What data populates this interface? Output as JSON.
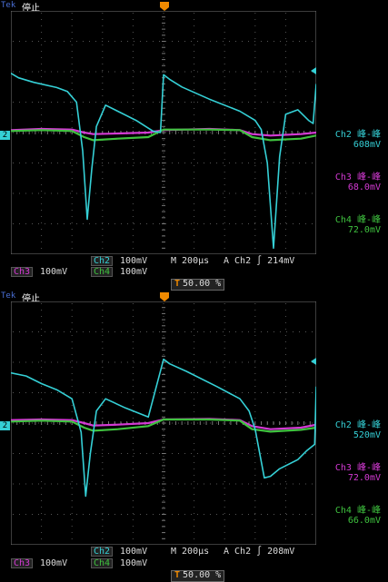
{
  "screens": [
    {
      "id": "top",
      "brand": "Tek",
      "run_state": "停止",
      "ch2_marker": "2",
      "measurements": [
        {
          "label": "Ch2 峰-峰",
          "value": "608mV",
          "color": "#35d0d6"
        },
        {
          "label": "Ch3 峰-峰",
          "value": "68.0mV",
          "color": "#d43ad4"
        },
        {
          "label": "Ch4 峰-峰",
          "value": "72.0mV",
          "color": "#3fc23f"
        }
      ],
      "status": {
        "ch2": "Ch2",
        "ch2_scale": "100mV",
        "ch3": "Ch3",
        "ch3_scale": "100mV",
        "ch4": "Ch4",
        "ch4_scale": "100mV",
        "timebase": "M 200µs",
        "trigger": "A  Ch2  ∫  214mV",
        "trig_pos": "50.00 %",
        "trig_mark": "T"
      }
    },
    {
      "id": "bottom",
      "brand": "Tek",
      "run_state": "停止",
      "ch2_marker": "2",
      "measurements": [
        {
          "label": "Ch2 峰-峰",
          "value": "520mV",
          "color": "#35d0d6"
        },
        {
          "label": "Ch3 峰-峰",
          "value": "72.0mV",
          "color": "#d43ad4"
        },
        {
          "label": "Ch4 峰-峰",
          "value": "66.0mV",
          "color": "#3fc23f"
        }
      ],
      "status": {
        "ch2": "Ch2",
        "ch2_scale": "100mV",
        "ch3": "Ch3",
        "ch3_scale": "100mV",
        "ch4": "Ch4",
        "ch4_scale": "100mV",
        "timebase": "M 200µs",
        "trigger": "A  Ch2  ∫  208mV",
        "trig_pos": "50.00 %",
        "trig_mark": "T"
      }
    }
  ],
  "chart_data": [
    {
      "type": "line",
      "title": "",
      "xlabel": "",
      "ylabel": "",
      "xlim": [
        -1000,
        1000
      ],
      "ylim": [
        -400,
        400
      ],
      "x_unit": "µs",
      "y_unit": "mV",
      "grid": true,
      "series": [
        {
          "name": "Ch2",
          "color": "#35d0d6",
          "points": [
            [
              -1000,
              195
            ],
            [
              -950,
              180
            ],
            [
              -850,
              165
            ],
            [
              -700,
              148
            ],
            [
              -630,
              135
            ],
            [
              -570,
              100
            ],
            [
              -530,
              -60
            ],
            [
              -500,
              -285
            ],
            [
              -470,
              -120
            ],
            [
              -440,
              20
            ],
            [
              -380,
              90
            ],
            [
              -300,
              70
            ],
            [
              -180,
              40
            ],
            [
              -70,
              5
            ],
            [
              -20,
              0
            ],
            [
              0,
              190
            ],
            [
              40,
              175
            ],
            [
              120,
              150
            ],
            [
              300,
              110
            ],
            [
              500,
              70
            ],
            [
              600,
              40
            ],
            [
              640,
              10
            ],
            [
              680,
              -100
            ],
            [
              720,
              -380
            ],
            [
              760,
              -80
            ],
            [
              800,
              60
            ],
            [
              880,
              75
            ],
            [
              950,
              40
            ],
            [
              980,
              30
            ],
            [
              1000,
              160
            ]
          ]
        },
        {
          "name": "Ch3",
          "color": "#d43ad4",
          "points": [
            [
              -1000,
              8
            ],
            [
              -800,
              12
            ],
            [
              -600,
              10
            ],
            [
              -520,
              0
            ],
            [
              -460,
              -5
            ],
            [
              -300,
              -3
            ],
            [
              -100,
              0
            ],
            [
              0,
              8
            ],
            [
              300,
              12
            ],
            [
              500,
              8
            ],
            [
              580,
              -5
            ],
            [
              700,
              -10
            ],
            [
              900,
              -5
            ],
            [
              1000,
              0
            ]
          ]
        },
        {
          "name": "Ch4",
          "color": "#3fc23f",
          "points": [
            [
              -1000,
              5
            ],
            [
              -800,
              8
            ],
            [
              -600,
              5
            ],
            [
              -520,
              -15
            ],
            [
              -460,
              -25
            ],
            [
              -300,
              -20
            ],
            [
              -100,
              -15
            ],
            [
              0,
              10
            ],
            [
              300,
              10
            ],
            [
              500,
              8
            ],
            [
              580,
              -15
            ],
            [
              700,
              -25
            ],
            [
              900,
              -20
            ],
            [
              1000,
              -10
            ]
          ]
        }
      ]
    },
    {
      "type": "line",
      "title": "",
      "xlabel": "",
      "ylabel": "",
      "xlim": [
        -1000,
        1000
      ],
      "ylim": [
        -400,
        400
      ],
      "x_unit": "µs",
      "y_unit": "mV",
      "grid": true,
      "series": [
        {
          "name": "Ch2",
          "color": "#35d0d6",
          "points": [
            [
              -1000,
              165
            ],
            [
              -900,
              155
            ],
            [
              -800,
              130
            ],
            [
              -700,
              110
            ],
            [
              -600,
              80
            ],
            [
              -540,
              -30
            ],
            [
              -510,
              -240
            ],
            [
              -480,
              -100
            ],
            [
              -440,
              40
            ],
            [
              -380,
              80
            ],
            [
              -250,
              50
            ],
            [
              -100,
              20
            ],
            [
              0,
              210
            ],
            [
              40,
              195
            ],
            [
              150,
              170
            ],
            [
              350,
              120
            ],
            [
              500,
              80
            ],
            [
              560,
              40
            ],
            [
              600,
              -20
            ],
            [
              660,
              -180
            ],
            [
              700,
              -175
            ],
            [
              760,
              -150
            ],
            [
              880,
              -120
            ],
            [
              940,
              -90
            ],
            [
              990,
              -70
            ],
            [
              1000,
              120
            ]
          ]
        },
        {
          "name": "Ch3",
          "color": "#d43ad4",
          "points": [
            [
              -1000,
              10
            ],
            [
              -800,
              12
            ],
            [
              -600,
              10
            ],
            [
              -520,
              0
            ],
            [
              -460,
              -8
            ],
            [
              -300,
              -5
            ],
            [
              -100,
              0
            ],
            [
              0,
              12
            ],
            [
              300,
              14
            ],
            [
              500,
              10
            ],
            [
              580,
              -10
            ],
            [
              700,
              -20
            ],
            [
              900,
              -15
            ],
            [
              1000,
              -5
            ]
          ]
        },
        {
          "name": "Ch4",
          "color": "#3fc23f",
          "points": [
            [
              -1000,
              5
            ],
            [
              -800,
              8
            ],
            [
              -600,
              5
            ],
            [
              -520,
              -15
            ],
            [
              -460,
              -25
            ],
            [
              -300,
              -20
            ],
            [
              -100,
              -10
            ],
            [
              0,
              12
            ],
            [
              300,
              12
            ],
            [
              500,
              8
            ],
            [
              580,
              -20
            ],
            [
              700,
              -28
            ],
            [
              900,
              -22
            ],
            [
              1000,
              -15
            ]
          ]
        }
      ]
    }
  ]
}
